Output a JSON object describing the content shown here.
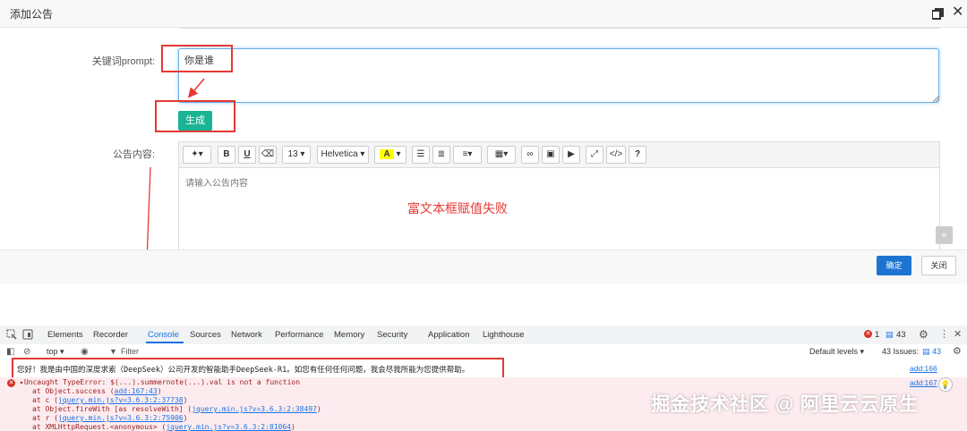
{
  "modal": {
    "title": "添加公告",
    "prompt_label": "关键词prompt:",
    "prompt_value": "你是谁",
    "generate_label": "生成",
    "content_label": "公告内容:",
    "editor_placeholder": "请输入公告内容",
    "annotation_text": "富文本框赋值失败",
    "confirm_label": "确定",
    "close_label": "关闭"
  },
  "editor_toolbar": {
    "font_size": "13",
    "font_family": "Helvetica",
    "color_sample": "A"
  },
  "devtools": {
    "tabs": [
      "Elements",
      "Recorder",
      "Console",
      "Sources",
      "Network",
      "Performance",
      "Memory",
      "Security",
      "Application",
      "Lighthouse"
    ],
    "active_tab": "Console",
    "error_count": "1",
    "message_count": "43",
    "context": "top",
    "filter_placeholder": "Filter",
    "levels": "Default levels",
    "issues": "43 Issues:",
    "issues_count": "43"
  },
  "console": {
    "log_message": "您好！我是由中国的深度求索（DeepSeek）公司开发的智能助手DeepSeek-R1。如您有任何任何问题，我会尽我所能为您提供帮助。",
    "log_source": "add:166",
    "error_message": "▸Uncaught TypeError: $(...).summernote(...).val is not a function",
    "error_source": "add:167",
    "stack": [
      {
        "prefix": "at Object.success (",
        "link": "add:167:43",
        "suffix": ")"
      },
      {
        "prefix": "at c (",
        "link": "jquery.min.js?v=3.6.3:2:37738",
        "suffix": ")"
      },
      {
        "prefix": "at Object.fireWith [as resolveWith] (",
        "link": "jquery.min.js?v=3.6.3:2:38497",
        "suffix": ")"
      },
      {
        "prefix": "at r (",
        "link": "jquery.min.js?v=3.6.3:2:75906",
        "suffix": ")"
      },
      {
        "prefix": "at XMLHttpRequest.<anonymous> (",
        "link": "jquery.min.js?v=3.6.3:2:81064",
        "suffix": ")"
      }
    ]
  },
  "watermark": "掘金技术社区 @ 阿里云云原生",
  "colors": {
    "generate_button": "#1ab394",
    "confirm_button": "#1e74d1",
    "callout_red": "#e53935",
    "error_bg": "#fdecef"
  }
}
